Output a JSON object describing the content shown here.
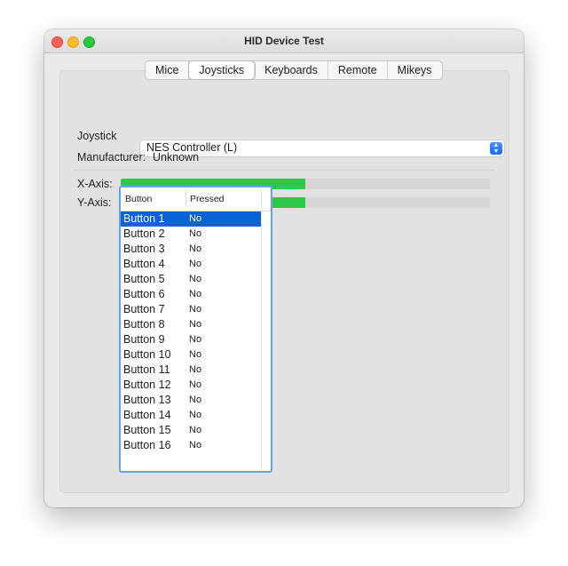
{
  "window": {
    "title": "HID Device Test"
  },
  "tabs": [
    {
      "label": "Mice",
      "active": false
    },
    {
      "label": "Joysticks",
      "active": true
    },
    {
      "label": "Keyboards",
      "active": false
    },
    {
      "label": "Remote",
      "active": false
    },
    {
      "label": "Mikeys",
      "active": false
    }
  ],
  "joystick": {
    "label": "Joystick",
    "selected": "NES Controller (L)",
    "manufacturer_label": "Manufacturer:",
    "manufacturer_value": "Unknown"
  },
  "axes": [
    {
      "label": "X-Axis:",
      "value_fraction": 0.5
    },
    {
      "label": "Y-Axis:",
      "value_fraction": 0.5
    }
  ],
  "colors": {
    "bar_fill": "#2ac94a",
    "selection": "#0a63d6",
    "focus_ring": "#6b9ff0"
  },
  "button_table": {
    "headers": {
      "button": "Button",
      "pressed": "Pressed"
    },
    "selected_index": 0,
    "rows": [
      {
        "button": "Button 1",
        "pressed": "No"
      },
      {
        "button": "Button 2",
        "pressed": "No"
      },
      {
        "button": "Button 3",
        "pressed": "No"
      },
      {
        "button": "Button 4",
        "pressed": "No"
      },
      {
        "button": "Button 5",
        "pressed": "No"
      },
      {
        "button": "Button 6",
        "pressed": "No"
      },
      {
        "button": "Button 7",
        "pressed": "No"
      },
      {
        "button": "Button 8",
        "pressed": "No"
      },
      {
        "button": "Button 9",
        "pressed": "No"
      },
      {
        "button": "Button 10",
        "pressed": "No"
      },
      {
        "button": "Button 11",
        "pressed": "No"
      },
      {
        "button": "Button 12",
        "pressed": "No"
      },
      {
        "button": "Button 13",
        "pressed": "No"
      },
      {
        "button": "Button 14",
        "pressed": "No"
      },
      {
        "button": "Button 15",
        "pressed": "No"
      },
      {
        "button": "Button 16",
        "pressed": "No"
      }
    ]
  }
}
